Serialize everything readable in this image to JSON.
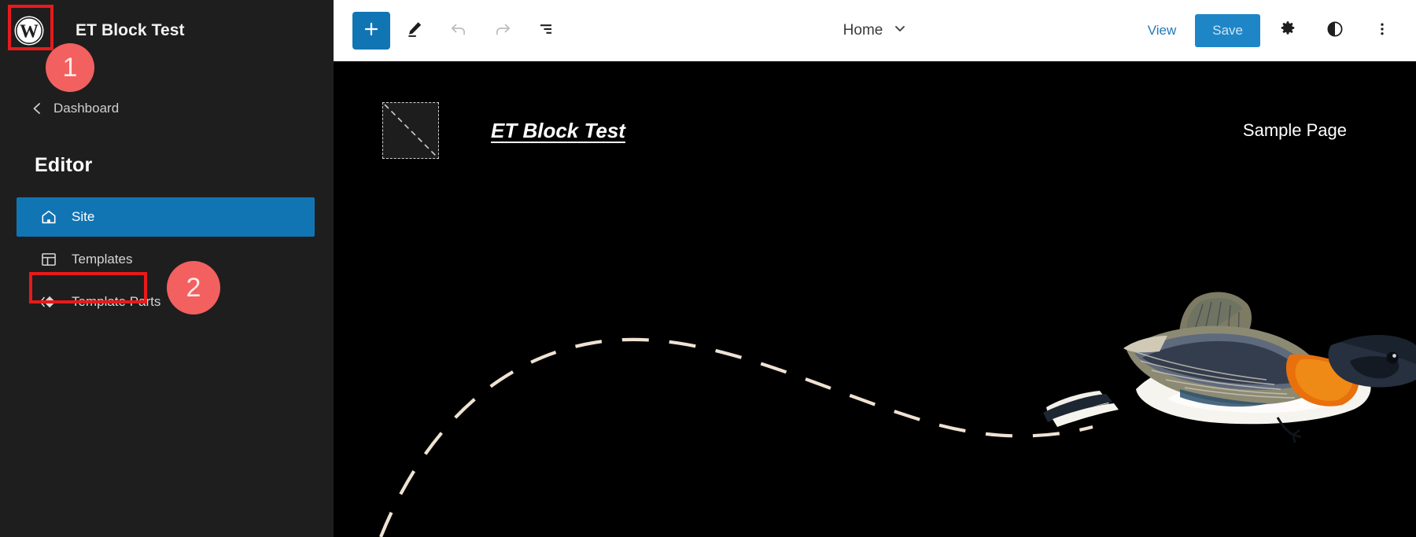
{
  "sidebar": {
    "logo_icon": "wordpress-logo-icon",
    "site_title": "ET Block Test",
    "back_label": "Dashboard",
    "back_icon": "chevron-left-icon",
    "section_title": "Editor",
    "items": [
      {
        "label": "Site",
        "icon": "home-icon",
        "active": true
      },
      {
        "label": "Templates",
        "icon": "templates-layout-icon",
        "active": false
      },
      {
        "label": "Template Parts",
        "icon": "template-parts-icon",
        "active": false
      }
    ]
  },
  "toolbar": {
    "add_block_label": "+",
    "add_block_icon": "plus-icon",
    "edit_icon": "pencil-edit-icon",
    "undo_icon": "undo-arrow-icon",
    "redo_icon": "redo-arrow-icon",
    "list_view_icon": "list-view-icon",
    "document_title": "Home",
    "document_chevron_icon": "chevron-down-icon",
    "view_label": "View",
    "save_label": "Save",
    "settings_icon": "gear-icon",
    "styles_icon": "contrast-half-circle-icon",
    "options_icon": "three-dots-vertical-icon"
  },
  "canvas": {
    "logo_placeholder_icon": "site-logo-placeholder-icon",
    "brand": "ET Block Test",
    "nav_link": "Sample Page",
    "artwork_icon": "flying-bird-illustration",
    "artwork_path_icon": "dashed-flight-path-icon"
  },
  "annotations": {
    "badges": [
      {
        "number": "1"
      },
      {
        "number": "2"
      }
    ],
    "highlight_color": "#e81a1a",
    "badge_color": "#f2605f"
  },
  "colors": {
    "accent_blue": "#1175b4",
    "sidebar_bg": "#1e1e1e",
    "canvas_bg": "#000000",
    "toolbar_bg": "#ffffff"
  }
}
